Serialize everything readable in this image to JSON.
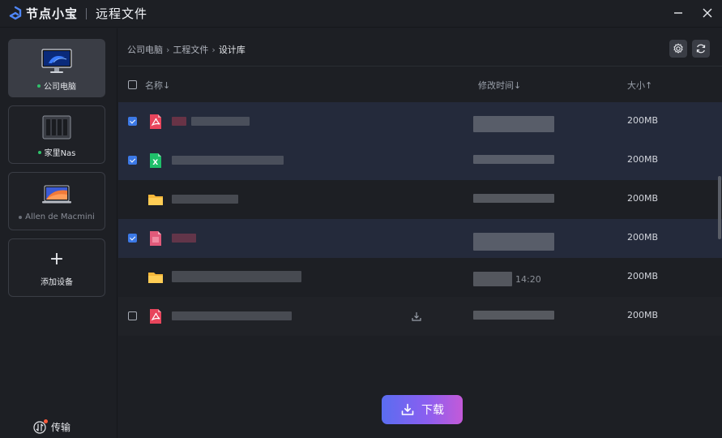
{
  "app": {
    "name": "节点小宝",
    "page_title": "远程文件"
  },
  "sidebar": {
    "devices": [
      {
        "label": "公司电脑",
        "online": true,
        "active": true,
        "icon": "desktop-monitor-icon"
      },
      {
        "label": "家里Nas",
        "online": true,
        "active": false,
        "icon": "nas-server-icon"
      },
      {
        "label": "Allen de Macmini",
        "online": false,
        "active": false,
        "icon": "laptop-icon"
      }
    ],
    "add_device_label": "添加设备",
    "transfer_label": "传输"
  },
  "breadcrumb": {
    "items": [
      "公司电脑",
      "工程文件",
      "设计库"
    ]
  },
  "table": {
    "headers": {
      "name": "名称↓",
      "modified": "修改时间↓",
      "size": "大小↑"
    },
    "rows": [
      {
        "type": "pdf",
        "checked": true,
        "size": "200MB",
        "time": "",
        "downloadable": false
      },
      {
        "type": "excel",
        "checked": true,
        "size": "200MB",
        "time": "",
        "downloadable": false
      },
      {
        "type": "folder",
        "checked": false,
        "size": "200MB",
        "time": "",
        "downloadable": false
      },
      {
        "type": "ppt",
        "checked": true,
        "size": "200MB",
        "time": "",
        "downloadable": false
      },
      {
        "type": "folder",
        "checked": false,
        "size": "200MB",
        "time": "14:20",
        "downloadable": false
      },
      {
        "type": "pdf",
        "checked": false,
        "size": "200MB",
        "time": "",
        "downloadable": true
      }
    ]
  },
  "actions": {
    "download_label": "下载"
  },
  "colors": {
    "accent": "#3c79e6",
    "selected_row": "#242a3b",
    "online": "#2fc26b",
    "pdf": "#e8455c",
    "excel": "#1fbf6a",
    "folder": "#f5b73a"
  }
}
